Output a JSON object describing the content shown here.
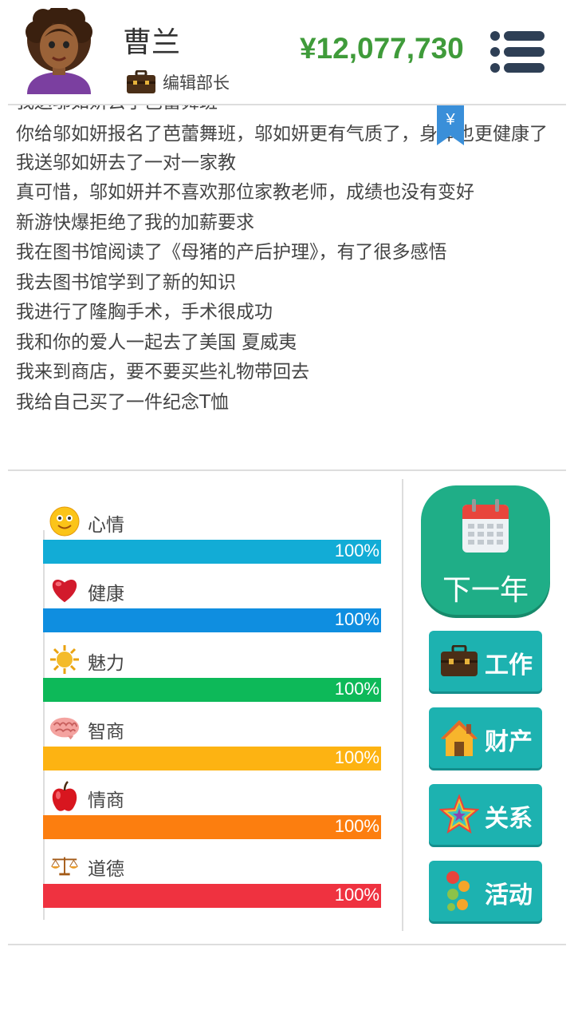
{
  "player": {
    "name": "曹兰",
    "job_title": "编辑部长",
    "money": "¥12,077,730"
  },
  "log": {
    "partial_line": "我送邬如妍去了芭蕾舞班",
    "lines": [
      "你给邬如妍报名了芭蕾舞班，邬如妍更有气质了，身体也更健康了",
      "我送邬如妍去了一对一家教",
      "真可惜，邬如妍并不喜欢那位家教老师，成绩也没有变好",
      "新游快爆拒绝了我的加薪要求",
      "我在图书馆阅读了《母猪的产后护理》，有了很多感悟",
      "我去图书馆学到了新的知识",
      "我进行了隆胸手术，手术很成功",
      "我和你的爱人一起去了美国 夏威夷",
      "我来到商店，要不要买些礼物带回去",
      "我给自己买了一件纪念T恤"
    ],
    "coin_symbol": "¥"
  },
  "stats": [
    {
      "label": "心情",
      "value": "100%",
      "fraction": 1.0,
      "color": "#12acd6",
      "icon": "smiley-icon"
    },
    {
      "label": "健康",
      "value": "100%",
      "fraction": 1.0,
      "color": "#0f8ee0",
      "icon": "heart-icon"
    },
    {
      "label": "魅力",
      "value": "100%",
      "fraction": 1.0,
      "color": "#0db959",
      "icon": "sun-icon"
    },
    {
      "label": "智商",
      "value": "100%",
      "fraction": 1.0,
      "color": "#fdb312",
      "icon": "brain-icon"
    },
    {
      "label": "情商",
      "value": "100%",
      "fraction": 1.0,
      "color": "#fc7e0f",
      "icon": "apple-icon"
    },
    {
      "label": "道德",
      "value": "100%",
      "fraction": 1.0,
      "color": "#ef3240",
      "icon": "scales-icon"
    }
  ],
  "actions": {
    "next_year": "下一年",
    "work": "工作",
    "property": "财产",
    "relations": "关系",
    "activities": "活动"
  },
  "colors": {
    "money": "#3f9b3a",
    "primary_button": "#1fae87",
    "side_button": "#1db2b0"
  }
}
